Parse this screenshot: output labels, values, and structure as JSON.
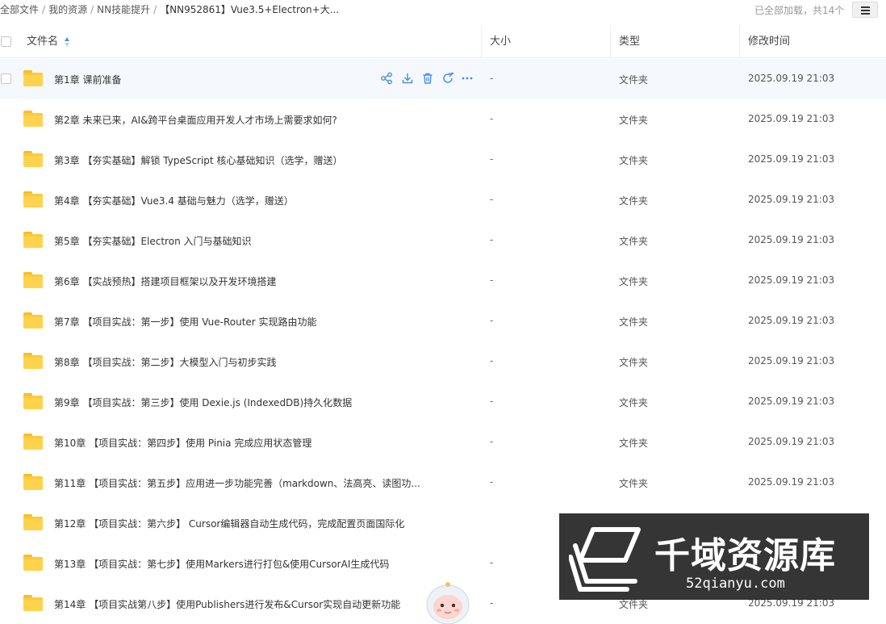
{
  "breadcrumb": {
    "items": [
      "全部文件",
      "我的资源",
      "NN技能提升",
      "【NN952861】Vue3.5+Electron+大..."
    ],
    "separator": "/"
  },
  "status": {
    "loaded_text": "已全部加载，共14个"
  },
  "table": {
    "columns": {
      "name": "文件名",
      "size": "大小",
      "type": "类型",
      "modified": "修改时间"
    },
    "rows": [
      {
        "name": "第1章 课前准备",
        "size": "-",
        "type": "文件夹",
        "modified": "2025.09.19 21:03"
      },
      {
        "name": "第2章 未来已来，AI&跨平台桌面应用开发人才市场上需要求如何?",
        "size": "-",
        "type": "文件夹",
        "modified": "2025.09.19 21:03"
      },
      {
        "name": "第3章 【夯实基础】解锁 TypeScript 核心基础知识（选学，赠送）",
        "size": "-",
        "type": "文件夹",
        "modified": "2025.09.19 21:03"
      },
      {
        "name": "第4章 【夯实基础】Vue3.4 基础与魅力（选学，赠送）",
        "size": "-",
        "type": "文件夹",
        "modified": "2025.09.19 21:03"
      },
      {
        "name": "第5章 【夯实基础】Electron 入门与基础知识",
        "size": "-",
        "type": "文件夹",
        "modified": "2025.09.19 21:03"
      },
      {
        "name": "第6章 【实战预热】搭建项目框架以及开发环境搭建",
        "size": "-",
        "type": "文件夹",
        "modified": "2025.09.19 21:03"
      },
      {
        "name": "第7章 【项目实战：第一步】使用 Vue-Router 实现路由功能",
        "size": "-",
        "type": "文件夹",
        "modified": "2025.09.19 21:03"
      },
      {
        "name": "第8章 【项目实战：第二步】大模型入门与初步实践",
        "size": "-",
        "type": "文件夹",
        "modified": "2025.09.19 21:03"
      },
      {
        "name": "第9章 【项目实战：第三步】使用 Dexie.js (IndexedDB)持久化数据",
        "size": "-",
        "type": "文件夹",
        "modified": "2025.09.19 21:03"
      },
      {
        "name": "第10章 【项目实战：第四步】使用 Pinia 完成应用状态管理",
        "size": "-",
        "type": "文件夹",
        "modified": "2025.09.19 21:03"
      },
      {
        "name": "第11章 【项目实战：第五步】应用进一步功能完善（markdown、法高亮、读图功...",
        "size": "-",
        "type": "文件夹",
        "modified": "2025.09.19 21:03"
      },
      {
        "name": "第12章 【项目实战：第六步】 Cursor编辑器自动生成代码，完成配置页面国际化",
        "size": "",
        "type": "",
        "modified": ""
      },
      {
        "name": "第13章 【项目实战：第七步】使用Markers进行打包&使用CursorAI生成代码",
        "size": "-",
        "type": "",
        "modified": ""
      },
      {
        "name": "第14章 【项目实战第八步】使用Publishers进行发布&Cursor实现自动更新功能",
        "size": "-",
        "type": "文件夹",
        "modified": "2025.09.19 21:03"
      }
    ]
  },
  "watermark": {
    "title": "千域资源库",
    "url": "52qianyu.com"
  },
  "icons": {
    "row_actions": [
      "share-icon",
      "download-icon",
      "delete-icon",
      "refresh-icon",
      "more-icon"
    ],
    "menu": "list-menu-icon",
    "folder": "folder-icon"
  },
  "colors": {
    "accent": "#4a90e2",
    "folder": "#fcca3a",
    "hover_row": "#f5f8fd"
  }
}
